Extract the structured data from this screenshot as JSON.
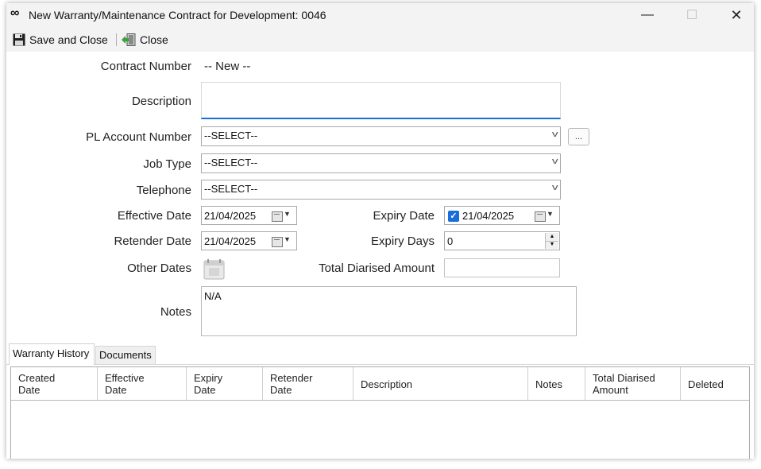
{
  "window": {
    "title": "New Warranty/Maintenance Contract for Development: 0046",
    "app_icon": "infinity-icon",
    "controls": {
      "minimize": "—",
      "maximize": "☐",
      "close": "✕"
    }
  },
  "toolbar": {
    "save_close_label": "Save and Close",
    "close_label": "Close"
  },
  "form": {
    "contract_number_label": "Contract Number",
    "contract_number_value": "-- New --",
    "description_label": "Description",
    "description_value": "",
    "pl_account_label": "PL Account Number",
    "pl_account_value": "--SELECT--",
    "pl_account_lookup": "...",
    "job_type_label": "Job Type",
    "job_type_value": "--SELECT--",
    "telephone_label": "Telephone",
    "telephone_value": "--SELECT--",
    "effective_date_label": "Effective Date",
    "effective_date_value": "21/04/2025",
    "expiry_date_label": "Expiry Date",
    "expiry_date_value": "21/04/2025",
    "expiry_date_checked": true,
    "retender_date_label": "Retender Date",
    "retender_date_value": "21/04/2025",
    "expiry_days_label": "Expiry Days",
    "expiry_days_value": "0",
    "other_dates_label": "Other Dates",
    "total_diarised_label": "Total Diarised Amount",
    "total_diarised_value": "",
    "notes_label": "Notes",
    "notes_value": "N/A"
  },
  "tabs": [
    {
      "label": "Warranty History",
      "active": true
    },
    {
      "label": "Documents",
      "active": false
    }
  ],
  "grid": {
    "columns": [
      {
        "line1": "Created",
        "line2": "Date"
      },
      {
        "line1": "Effective",
        "line2": "Date"
      },
      {
        "line1": "Expiry",
        "line2": "Date"
      },
      {
        "line1": "Retender",
        "line2": "Date"
      },
      {
        "line1": "Description",
        "line2": ""
      },
      {
        "line1": "Notes",
        "line2": ""
      },
      {
        "line1": "Total Diarised",
        "line2": "Amount"
      },
      {
        "line1": "Deleted",
        "line2": ""
      }
    ],
    "rows": []
  },
  "colors": {
    "accent": "#1a6ed8",
    "titlebar_bg": "#f3f3f3",
    "border": "#a9a9a9"
  }
}
